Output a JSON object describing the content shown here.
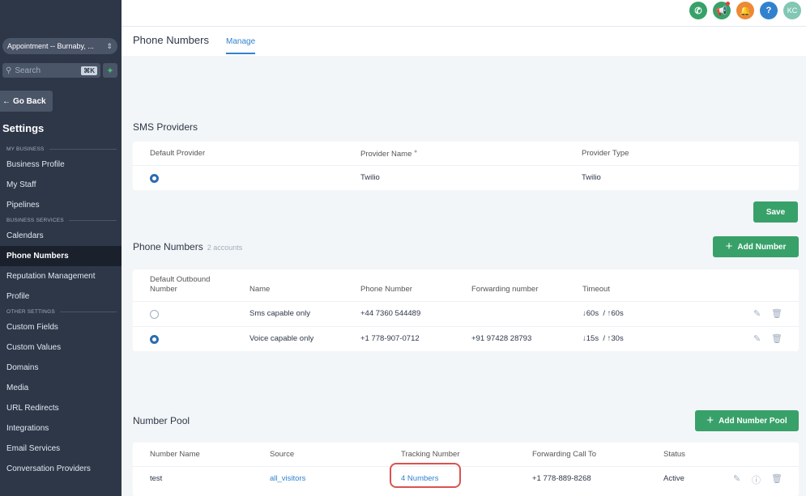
{
  "sidebar": {
    "location": "Appointment -- Burnaby, ...",
    "search_placeholder": "Search",
    "search_shortcut": "⌘K",
    "go_back": "Go Back",
    "settings_title": "Settings",
    "sections": [
      {
        "label": "MY BUSINESS",
        "items": [
          "Business Profile",
          "My Staff",
          "Pipelines"
        ]
      },
      {
        "label": "BUSINESS SERVICES",
        "items": [
          "Calendars",
          "Phone Numbers",
          "Reputation Management",
          "Profile"
        ]
      },
      {
        "label": "OTHER SETTINGS",
        "items": [
          "Custom Fields",
          "Custom Values",
          "Domains",
          "Media",
          "URL Redirects",
          "Integrations",
          "Email Services",
          "Conversation Providers"
        ]
      }
    ],
    "active_item": "Phone Numbers"
  },
  "topbar": {
    "avatar_initials": "KC",
    "icons": [
      "phone-icon",
      "megaphone-icon",
      "bell-icon",
      "help-icon"
    ],
    "colors": {
      "phone": "#38a169",
      "megaphone": "#38a169",
      "bell": "#ed8936",
      "help": "#3182ce",
      "avatar": "#81c7b3"
    }
  },
  "header": {
    "title": "Phone Numbers",
    "tab": "Manage"
  },
  "sms_providers": {
    "title": "SMS Providers",
    "columns": [
      "Default Provider",
      "Provider Name",
      "Provider Type"
    ],
    "rows": [
      {
        "name": "Twilio",
        "type": "Twilio",
        "default": true
      }
    ],
    "save_label": "Save"
  },
  "phone_numbers": {
    "title": "Phone Numbers",
    "count": "2 accounts",
    "add_label": "Add Number",
    "columns": [
      "Default Outbound Number",
      "Name",
      "Phone Number",
      "Forwarding number",
      "Timeout"
    ],
    "rows": [
      {
        "default": false,
        "name": "Sms capable only",
        "phone": "+44 7360 544489",
        "forwarding": "",
        "timeout_in": "60s",
        "timeout_out": "60s"
      },
      {
        "default": true,
        "name": "Voice capable only",
        "phone": "+1 778-907-0712",
        "forwarding": "+91 97428 28793",
        "timeout_in": "15s",
        "timeout_out": "30s"
      }
    ]
  },
  "number_pool": {
    "title": "Number Pool",
    "add_label": "Add Number Pool",
    "columns": [
      "Number Name",
      "Source",
      "Tracking Number",
      "Forwarding Call To",
      "Status"
    ],
    "rows": [
      {
        "name": "test",
        "source": "all_visitors",
        "tracking": "4 Numbers",
        "forwarding": "+1 778-889-8268",
        "status": "Active"
      }
    ]
  },
  "accent_colors": {
    "primary": "#3182ce",
    "success": "#38a169",
    "sidebar": "#2d3748",
    "highlight": "#d9534f"
  }
}
